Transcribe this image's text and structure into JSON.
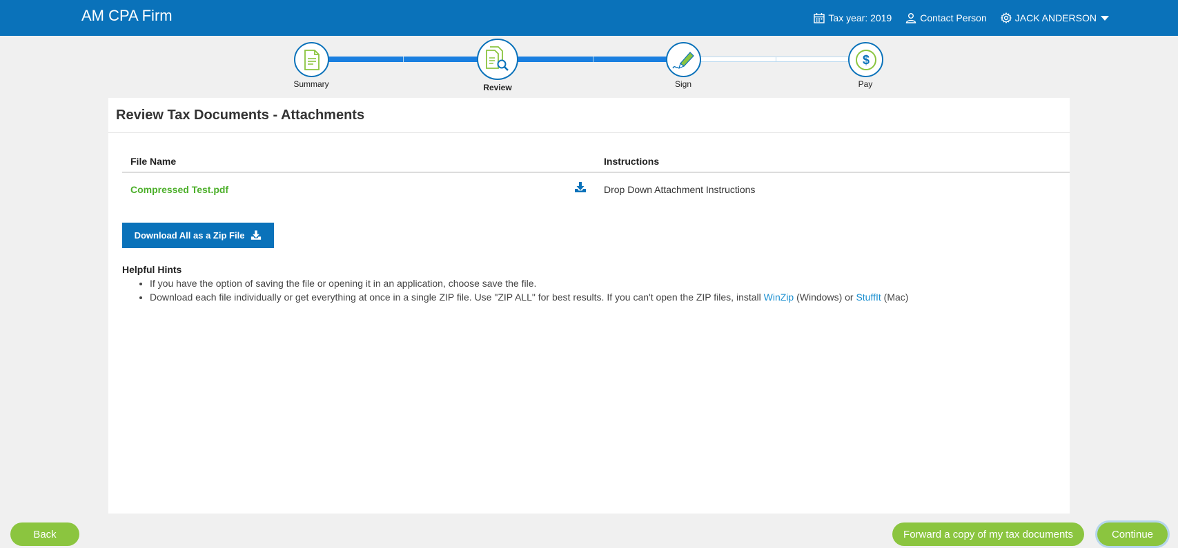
{
  "header": {
    "brand": "AM CPA Firm",
    "tax_year": "Tax year: 2019",
    "contact": "Contact Person",
    "user": "JACK ANDERSON"
  },
  "stepper": {
    "steps": [
      {
        "label": "Summary",
        "icon": "document-icon",
        "state": "done"
      },
      {
        "label": "Review",
        "icon": "review-document-icon",
        "state": "active"
      },
      {
        "label": "Sign",
        "icon": "pen-sign-icon",
        "state": "todo"
      },
      {
        "label": "Pay",
        "icon": "dollar-icon",
        "state": "todo"
      }
    ]
  },
  "page": {
    "title": "Review Tax Documents - Attachments"
  },
  "table": {
    "headers": {
      "file_name": "File Name",
      "instructions": "Instructions"
    },
    "rows": [
      {
        "file_name": "Compressed Test.pdf",
        "instructions": "Drop Down Attachment Instructions"
      }
    ]
  },
  "zip_button": "Download All as a Zip File",
  "hints": {
    "title": "Helpful Hints",
    "item1": "If you have the option of saving the file or opening it in an application, choose save the file.",
    "item2_a": "Download each file individually or get everything at once in a single ZIP file. Use \"ZIP ALL\" for best results. If you can't open the ZIP files, install ",
    "winzip": "WinZip",
    "item2_b": " (Windows) or ",
    "stuffit": "StuffIt",
    "item2_c": " (Mac)"
  },
  "footer": {
    "back": "Back",
    "forward": "Forward a copy of my tax documents",
    "continue": "Continue"
  },
  "colors": {
    "brand_blue": "#0a72ba",
    "green": "#8bc53f",
    "link_green": "#4caf2a",
    "link_blue": "#1a8fd0"
  }
}
